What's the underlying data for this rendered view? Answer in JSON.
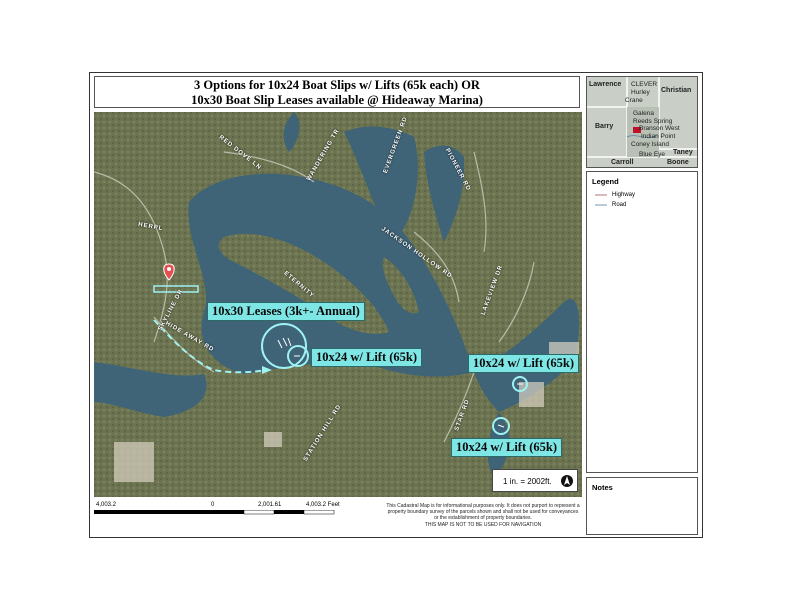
{
  "title": {
    "line1": "3 Options for 10x24 Boat Slips w/ Lifts (65k each) OR",
    "line2": "10x30 Boat Slip Leases available @ Hideaway Marina)"
  },
  "callouts": {
    "leases": "10x30 Leases (3k+- Annual)",
    "lift_a": "10x24 w/ Lift (65k)",
    "lift_b": "10x24 w/ Lift (65k)",
    "lift_c": "10x24 w/ Lift (65k)"
  },
  "roads": {
    "r1": "HERPL",
    "r2": "RED DOVE LN",
    "r3": "WANDERING TR",
    "r4": "EVERGREEN RD",
    "r5": "PIONEER RD",
    "r6": "ETERNITY",
    "r7": "JACKSON HOLLOW RD",
    "r8": "SKYLINE DR",
    "r9": "HIDE AWAY RD",
    "r10": "LAKEVIEW DR",
    "r11": "STATION HILL RD",
    "r12": "STAR RD"
  },
  "inset": {
    "counties": [
      "Lawrence",
      "Christian",
      "Barry",
      "Taney",
      "Carroll",
      "Boone"
    ],
    "towns": [
      "CLEVER",
      "Hurley",
      "Crane",
      "Galena",
      "Reeds Spring",
      "Branson West",
      "Indian Point",
      "Coney Island",
      "Blue Eye"
    ]
  },
  "legend": {
    "title": "Legend",
    "items": [
      {
        "label": "Highway",
        "color": "#d9b9b9"
      },
      {
        "label": "Road",
        "color": "#b9c9d9"
      }
    ]
  },
  "notes": {
    "title": "Notes"
  },
  "scale": {
    "text": "1 in. = 2002ft.",
    "ticks": [
      "4,003.2",
      "0",
      "2,001.61",
      "4,003.2 Feet"
    ]
  },
  "disclaimer": {
    "text": "This Cadastral Map is for informational purposes only.  It does not purport to represent a property boundary survey of the parcels shown and shall not be used for conveyances or the establishment of property boundaries.",
    "warning": "THIS MAP IS NOT TO BE USED FOR NAVIGATION"
  },
  "colors": {
    "highlight": "#7fe6e6",
    "water": "#3f6478",
    "land": "#6b7350"
  }
}
